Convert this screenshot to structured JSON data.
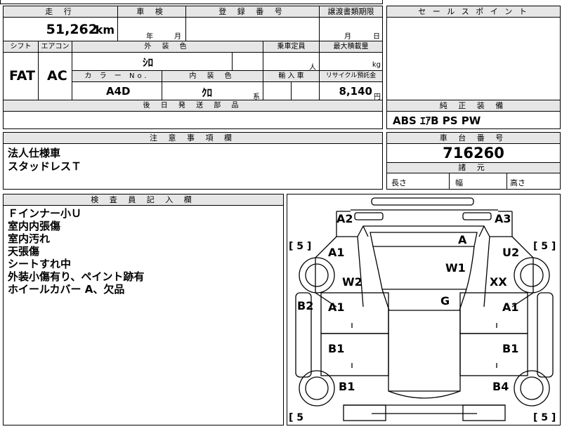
{
  "basic": {
    "mileage_label": "走 行",
    "mileage_value": "51,262",
    "mileage_unit": "km",
    "inspection_label": "車 検",
    "year_char": "年",
    "month_char": "月",
    "registration_label": "登 録 番 号",
    "transfer_label": "譲渡書類期限",
    "transfer_month": "月",
    "transfer_day": "日",
    "shift_label": "シフト",
    "ac_label": "エアコン",
    "exterior_color_label": "外 装 色",
    "capacity_label": "乗車定員",
    "max_load_label": "最大積載量",
    "shift_value": "FAT",
    "ac_value": "AC",
    "exterior_color_value": "ｼﾛ",
    "capacity_unit": "人",
    "max_load_unit": "kg",
    "color_no_label": "カ ラ ー No.",
    "interior_color_label": "内 装 色",
    "import_label": "輸 入 車",
    "recycle_label": "リサイクル預託金",
    "color_no_value": "A4D",
    "interior_color_value": "ｸﾛ",
    "interior_suffix": "系",
    "recycle_value": "8,140",
    "recycle_unit": "円",
    "later_parts_label": "後 日 発 送 部 品"
  },
  "sales_points": {
    "label": "セ ー ル ス ポ イ ン ト"
  },
  "equipment": {
    "label": "純 正 装 備",
    "value": "ABS ｴｱB PS PW"
  },
  "notes": {
    "label": "注 意 事 項 欄",
    "lines": [
      "法人仕様車",
      "スタッドレスＴ"
    ]
  },
  "chassis": {
    "label": "車 台 番 号",
    "value": "716260"
  },
  "specs": {
    "label": "諸 元",
    "length": "長さ",
    "width": "幅",
    "height": "高さ"
  },
  "inspector": {
    "label": "検 査 員 記 入 欄",
    "lines": [
      "Ｆインナー小Ｕ",
      "室内内張傷",
      "室内汚れ",
      "天張傷",
      "シートすれ中",
      "外装小傷有り、ペイント跡有",
      "ホイールカバー A、欠品"
    ]
  },
  "diagram": {
    "marks": {
      "rear_left": "A2",
      "rear_right": "A3",
      "rear_center": "A",
      "left_upper": "A1",
      "right_upper": "U2",
      "left_w": "W2",
      "center_w": "W1",
      "right_xx": "XX",
      "roof": "G",
      "left_door1": "A1",
      "right_door1": "A1",
      "left_door2": "B1",
      "right_door2": "B1",
      "left_b2": "B2",
      "left_front": "B1",
      "right_front": "B4"
    },
    "tire_tl": "[ 5 ]",
    "tire_tr": "[ 5 ]",
    "tire_bl": "[ 5",
    "tire_br": "[ 5 ]"
  }
}
